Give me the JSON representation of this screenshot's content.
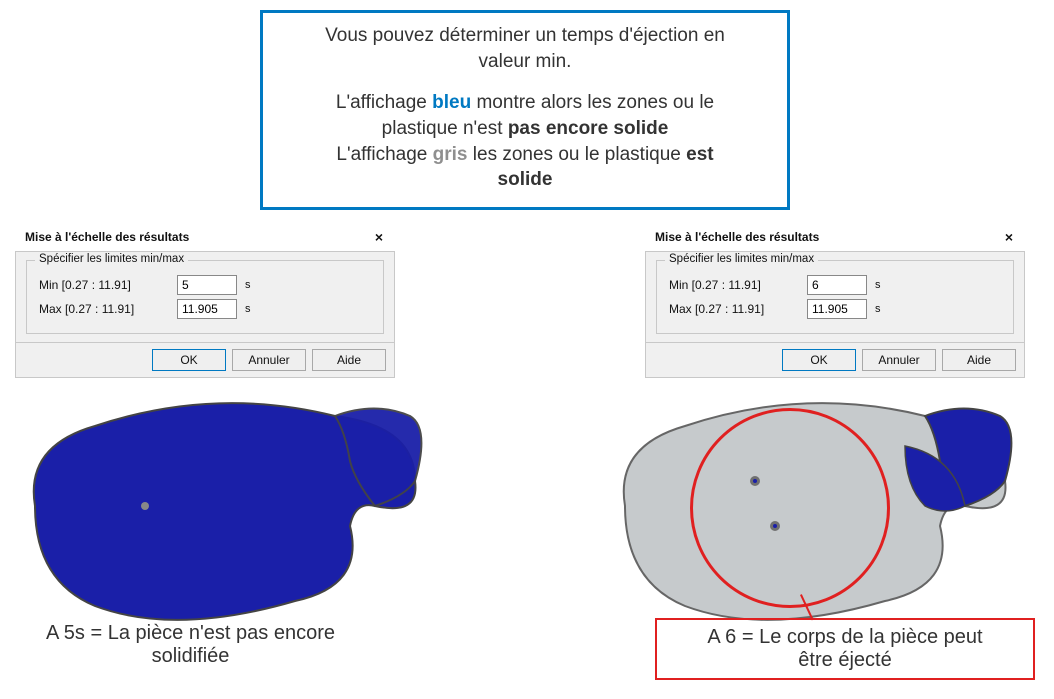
{
  "info": {
    "line1a": "Vous pouvez déterminer un temps d'éjection en",
    "line1b": "valeur min.",
    "line2a": "L'affichage ",
    "line2_bleu": "bleu",
    "line2b": " montre alors les zones ou le",
    "line2c": "plastique n'est ",
    "line2_bold1": "pas encore solide",
    "line3a": "L'affichage ",
    "line3_gris": "gris",
    "line3b": " les zones ou le plastique ",
    "line3_bold": "est",
    "line3c": "solide"
  },
  "dialog": {
    "title": "Mise à l'échelle des résultats",
    "close": "×",
    "group_legend": "Spécifier les limites min/max",
    "min_label": "Min [0.27 : 11.91]",
    "max_label": "Max [0.27 : 11.91]",
    "unit": "s",
    "max_value": "11.905",
    "ok": "OK",
    "cancel": "Annuler",
    "help": "Aide"
  },
  "left": {
    "min_value": "5",
    "caption_a": "A 5s = La pièce n'est pas encore",
    "caption_b": "solidifiée"
  },
  "right": {
    "min_value": "6",
    "caption_a": "A 6 = Le corps de la pièce peut",
    "caption_b": "être éjecté"
  },
  "icons": {
    "close": "close-icon"
  },
  "colors": {
    "blue": "#0079c2",
    "red": "#e02020",
    "part_blue": "#1a1fa8",
    "part_gray": "#b8bcc0"
  }
}
